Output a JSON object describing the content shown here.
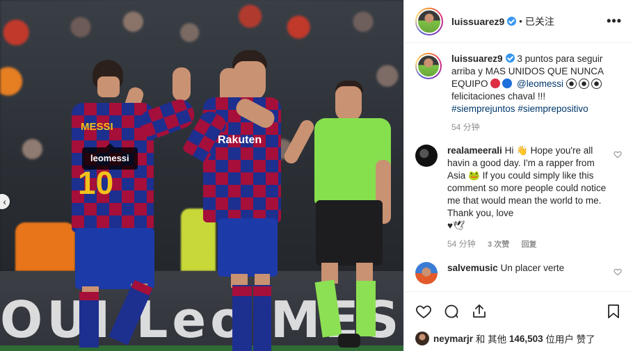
{
  "post": {
    "author": "luissuarez9",
    "follow_state": "已关注",
    "separator": "•",
    "more_label": "•••"
  },
  "photo": {
    "tag_label": "leomessi",
    "jersey_name": "MESSI",
    "jersey_number": "10",
    "sponsor": "Rakuten",
    "adboard_text": "OUI  Leo MESS"
  },
  "caption": {
    "user": "luissuarez9",
    "text_part1": "3 puntos para seguir arriba y MAS UNIDOS QUE NUNCA EQUIPO",
    "mention": "@leomessi",
    "text_part2": "felicitaciones chaval !!!",
    "hashtag1": "#siemprejuntos",
    "hashtag2": "#siemprepositivo",
    "time": "54 分钟"
  },
  "comments": [
    {
      "user": "realameerali",
      "text": "Hi 👋 Hope you're all havin a good day. I'm a rapper from Asia 🐸 If you could simply like this comment so more people could notice me that would mean the world to me. Thank you, love",
      "ending": "♥🕊",
      "time": "54 分钟",
      "likes": "3 次赞",
      "reply": "回复"
    },
    {
      "user": "salvemusic",
      "text": "Un placer verte"
    }
  ],
  "likes": {
    "liker": "neymarjr",
    "connector": "和 其他",
    "count": "146,503",
    "suffix": "位用户 赞了"
  },
  "colors": {
    "link": "#00376b",
    "verified": "#3897f0",
    "muted": "#8e8e8e"
  },
  "icons": {
    "like": "heart-icon",
    "comment": "comment-icon",
    "share": "share-icon",
    "save": "bookmark-icon",
    "more": "more-icon",
    "prev": "chevron-left-icon"
  }
}
